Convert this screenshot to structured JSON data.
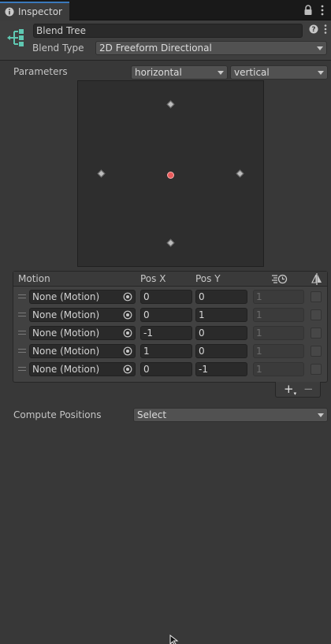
{
  "tab": {
    "title": "Inspector"
  },
  "header": {
    "name": "Blend Tree",
    "blend_type_label": "Blend Type",
    "blend_type_value": "2D Freeform Directional"
  },
  "parameters": {
    "label": "Parameters",
    "param_x": "horizontal",
    "param_y": "vertical"
  },
  "plot_points": [
    {
      "name": "up",
      "x": 0,
      "y": 1
    },
    {
      "name": "left",
      "x": -1,
      "y": 0
    },
    {
      "name": "right",
      "x": 1,
      "y": 0
    },
    {
      "name": "down",
      "x": 0,
      "y": -1
    }
  ],
  "current_position": {
    "x": 0,
    "y": 0
  },
  "motion_list": {
    "headers": {
      "motion": "Motion",
      "pos_x": "Pos X",
      "pos_y": "Pos Y"
    },
    "rows": [
      {
        "motion": "None (Motion)",
        "pos_x": "0",
        "pos_y": "0",
        "speed": "1"
      },
      {
        "motion": "None (Motion)",
        "pos_x": "0",
        "pos_y": "1",
        "speed": "1"
      },
      {
        "motion": "None (Motion)",
        "pos_x": "-1",
        "pos_y": "0",
        "speed": "1"
      },
      {
        "motion": "None (Motion)",
        "pos_x": "1",
        "pos_y": "0",
        "speed": "1"
      },
      {
        "motion": "None (Motion)",
        "pos_x": "0",
        "pos_y": "-1",
        "speed": "1"
      }
    ],
    "add_label": "+",
    "remove_label": "−"
  },
  "compute": {
    "label": "Compute Positions",
    "value": "Select"
  },
  "colors": {
    "accent": "#3a79bb",
    "blend_tree_icon": "#5fc8b2",
    "current_point": "#e85a5a"
  }
}
